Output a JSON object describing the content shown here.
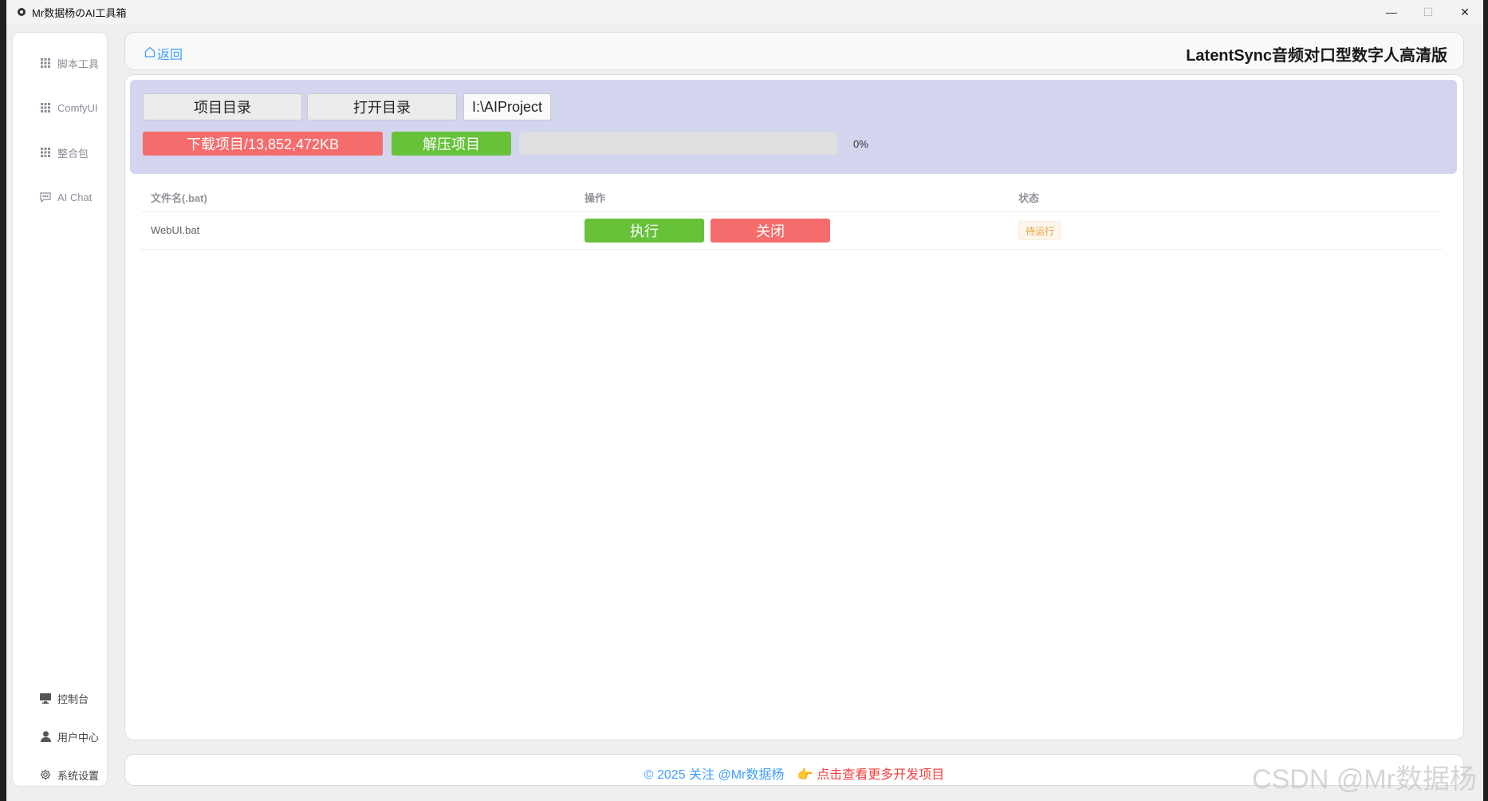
{
  "window": {
    "title": "Mr数据杨のAI工具箱",
    "minimize": "—",
    "maximize": "☐",
    "close": "✕"
  },
  "sidebar": {
    "items": [
      {
        "label": "脚本工具",
        "icon": "grid-icon"
      },
      {
        "label": "ComfyUI",
        "icon": "grid-icon"
      },
      {
        "label": "整合包",
        "icon": "grid-icon"
      },
      {
        "label": "AI Chat",
        "icon": "chat-icon"
      }
    ],
    "bottom_items": [
      {
        "label": "控制台",
        "icon": "monitor-icon"
      },
      {
        "label": "用户中心",
        "icon": "user-icon"
      },
      {
        "label": "系统设置",
        "icon": "gear-icon"
      }
    ]
  },
  "header": {
    "back_label": "返回",
    "title": "LatentSync音频对口型数字人高清版"
  },
  "controls": {
    "project_dir_label": "项目目录",
    "open_dir_label": "打开目录",
    "path_value": "I:\\AIProject",
    "download_label": "下载项目/13,852,472KB",
    "extract_label": "解压项目",
    "progress_percent": 0,
    "progress_text": "0%"
  },
  "table": {
    "columns": [
      "文件名(.bat)",
      "操作",
      "状态"
    ],
    "rows": [
      {
        "filename": "WebUI.bat",
        "run_label": "执行",
        "close_label": "关闭",
        "status": "待运行"
      }
    ]
  },
  "footer": {
    "copyright": "© 2025 关注 @Mr数据杨",
    "link_emoji": "👉",
    "link_text": "点击查看更多开发项目"
  },
  "watermark": "CSDN @Mr数据杨",
  "colors": {
    "accent": "#409eff",
    "danger": "#f56c6c",
    "success": "#67c23a",
    "panel": "#d3d5ef",
    "warning": "#e6a23c"
  }
}
